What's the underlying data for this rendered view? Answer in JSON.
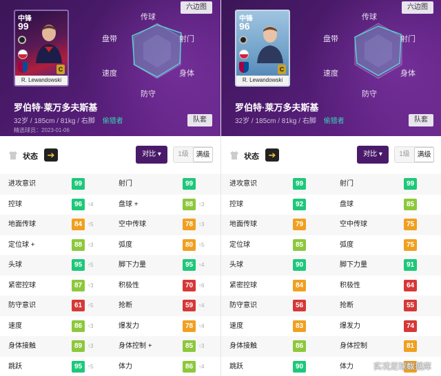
{
  "colors": {
    "hero_bg": "#4a1a6a",
    "accent_purple": "#4a1a6a",
    "style_teal": "#3ad2b8",
    "tier_green": "#1ec87a",
    "tier_lime": "#8dc83c",
    "tier_orange": "#f0a020",
    "tier_red": "#d63838"
  },
  "left": {
    "card": {
      "position": "中锋",
      "rating": "99",
      "name": "R. Lewandowski",
      "type": "legend"
    },
    "hexagon_button": "六边图",
    "radar_labels": {
      "top": "传球",
      "top_left": "盘带",
      "top_right": "射门",
      "bottom_left": "速度",
      "bottom_right": "身体",
      "bottom": "防守"
    },
    "player_name": "罗伯特·莱万多夫斯基",
    "player_info": "32岁 / 185cm / 81kg / 右脚",
    "play_style": "偷猎者",
    "note": "精选球员：2023-01-06",
    "team_button": "队套",
    "status_label": "状态",
    "compare_button": "对比",
    "level_1": "1级",
    "level_max": "满级",
    "rows": [
      {
        "l_name": "进攻意识",
        "l_val": "99",
        "l_color": "#1ec87a",
        "l_boost": "",
        "r_name": "射门",
        "r_val": "99",
        "r_color": "#1ec87a",
        "r_boost": ""
      },
      {
        "l_name": "控球",
        "l_val": "96",
        "l_color": "#1ec87a",
        "l_boost": "↑4",
        "r_name": "盘球 +",
        "r_val": "88",
        "r_color": "#8dc83c",
        "r_boost": "↑3"
      },
      {
        "l_name": "地面传球",
        "l_val": "84",
        "l_color": "#f0a020",
        "l_boost": "↑5",
        "r_name": "空中传球",
        "r_val": "78",
        "r_color": "#f0a020",
        "r_boost": "↑3"
      },
      {
        "l_name": "定位球 +",
        "l_val": "88",
        "l_color": "#8dc83c",
        "l_boost": "↑3",
        "r_name": "弧度",
        "r_val": "80",
        "r_color": "#f0a020",
        "r_boost": "↑5"
      },
      {
        "l_name": "头球",
        "l_val": "95",
        "l_color": "#1ec87a",
        "l_boost": "↑5",
        "r_name": "脚下力量",
        "r_val": "95",
        "r_color": "#1ec87a",
        "r_boost": "↑4"
      },
      {
        "l_name": "紧密控球",
        "l_val": "87",
        "l_color": "#8dc83c",
        "l_boost": "↑3",
        "r_name": "积极性",
        "r_val": "70",
        "r_color": "#d63838",
        "r_boost": "↑6"
      },
      {
        "l_name": "防守意识",
        "l_val": "61",
        "l_color": "#d63838",
        "l_boost": "↑5",
        "r_name": "抢断",
        "r_val": "59",
        "r_color": "#d63838",
        "r_boost": "↑4"
      },
      {
        "l_name": "速度",
        "l_val": "86",
        "l_color": "#8dc83c",
        "l_boost": "↑3",
        "r_name": "爆发力",
        "r_val": "78",
        "r_color": "#f0a020",
        "r_boost": "↑4"
      },
      {
        "l_name": "身体接触",
        "l_val": "89",
        "l_color": "#8dc83c",
        "l_boost": "↑3",
        "r_name": "身体控制 +",
        "r_val": "85",
        "r_color": "#8dc83c",
        "r_boost": "↑3"
      },
      {
        "l_name": "跳跃",
        "l_val": "95",
        "l_color": "#1ec87a",
        "l_boost": "↑5",
        "r_name": "体力",
        "r_val": "86",
        "r_color": "#8dc83c",
        "r_boost": "↑4"
      }
    ]
  },
  "right": {
    "card": {
      "position": "中锋",
      "rating": "96",
      "name": "R. Lewandowski",
      "type": "base"
    },
    "hexagon_button": "六边图",
    "radar_labels": {
      "top": "传球",
      "top_left": "盘带",
      "top_right": "射门",
      "bottom_left": "速度",
      "bottom_right": "身体",
      "bottom": "防守"
    },
    "player_name": "罗伯特·莱万多夫斯基",
    "player_info": "32岁 / 185cm / 81kg / 右脚",
    "play_style": "偷猎者",
    "team_button": "队套",
    "status_label": "状态",
    "compare_button": "对比",
    "level_1": "1级",
    "level_max": "满级",
    "rows": [
      {
        "l_name": "进攻意识",
        "l_val": "99",
        "l_color": "#1ec87a",
        "r_name": "射门",
        "r_val": "99",
        "r_color": "#1ec87a"
      },
      {
        "l_name": "控球",
        "l_val": "92",
        "l_color": "#1ec87a",
        "r_name": "盘球",
        "r_val": "85",
        "r_color": "#8dc83c"
      },
      {
        "l_name": "地面传球",
        "l_val": "79",
        "l_color": "#f0a020",
        "r_name": "空中传球",
        "r_val": "75",
        "r_color": "#f0a020"
      },
      {
        "l_name": "定位球",
        "l_val": "85",
        "l_color": "#8dc83c",
        "r_name": "弧度",
        "r_val": "75",
        "r_color": "#f0a020"
      },
      {
        "l_name": "头球",
        "l_val": "90",
        "l_color": "#1ec87a",
        "r_name": "脚下力量",
        "r_val": "91",
        "r_color": "#1ec87a"
      },
      {
        "l_name": "紧密控球",
        "l_val": "84",
        "l_color": "#f0a020",
        "r_name": "积极性",
        "r_val": "64",
        "r_color": "#d63838"
      },
      {
        "l_name": "防守意识",
        "l_val": "56",
        "l_color": "#d63838",
        "r_name": "抢断",
        "r_val": "55",
        "r_color": "#d63838"
      },
      {
        "l_name": "速度",
        "l_val": "83",
        "l_color": "#f0a020",
        "r_name": "爆发力",
        "r_val": "74",
        "r_color": "#d63838"
      },
      {
        "l_name": "身体接触",
        "l_val": "86",
        "l_color": "#8dc83c",
        "r_name": "身体控制",
        "r_val": "81",
        "r_color": "#f0a020"
      },
      {
        "l_name": "跳跃",
        "l_val": "90",
        "l_color": "#1ec87a",
        "r_name": "体力",
        "r_val": "82",
        "r_color": "#f0a020"
      }
    ]
  },
  "watermark": "实况足球数据库"
}
